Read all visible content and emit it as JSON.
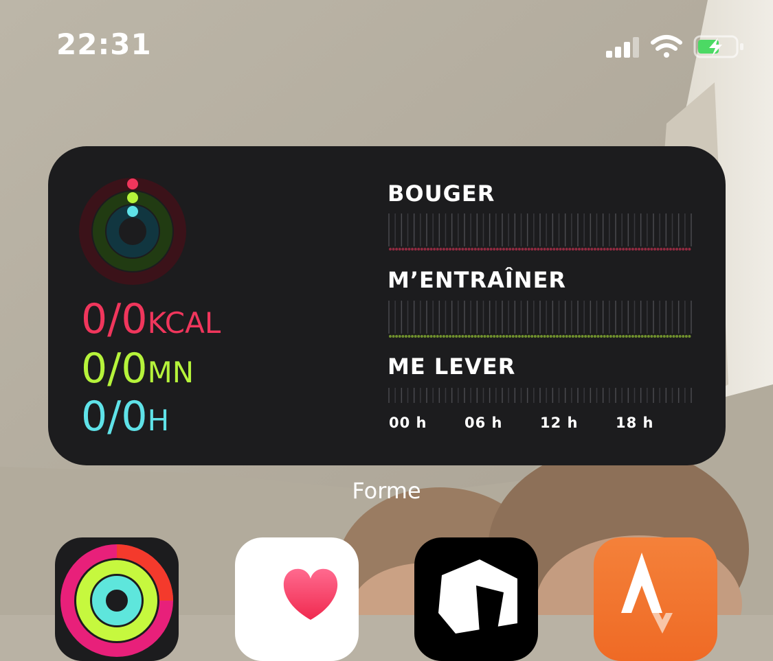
{
  "status_bar": {
    "time": "22:31",
    "signal_icon": "cellular-signal-icon",
    "wifi_icon": "wifi-icon",
    "battery_icon": "battery-charging-icon",
    "battery_color": "#4cd964"
  },
  "widget": {
    "caption": "Forme",
    "stats": {
      "move": {
        "value": "0/0",
        "unit": "KCAL"
      },
      "exercise": {
        "value": "0/0",
        "unit": "MN"
      },
      "stand": {
        "value": "0/0",
        "unit": "H"
      }
    },
    "sections": {
      "move": "BOUGER",
      "exercise": "M’ENTRAÎNER",
      "stand": "ME LEVER"
    },
    "hour_labels": [
      "00 h",
      "06 h",
      "12 h",
      "18 h"
    ],
    "colors": {
      "move": "#f0365c",
      "exercise": "#b6f33b",
      "stand": "#5fe2e8",
      "background": "#1c1c1e"
    }
  },
  "apps": [
    {
      "name": "fitness-app-icon"
    },
    {
      "name": "health-app-icon"
    },
    {
      "name": "black-app-icon"
    },
    {
      "name": "strava-app-icon"
    }
  ]
}
